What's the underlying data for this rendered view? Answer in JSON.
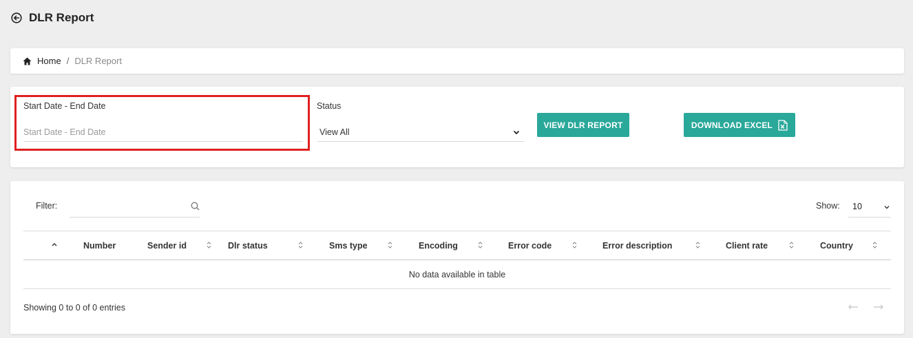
{
  "header": {
    "title": "DLR Report",
    "back_icon": "arrow-left-circle-icon"
  },
  "breadcrumb": {
    "home_label": "Home",
    "separator": "/",
    "current": "DLR Report",
    "home_icon": "home-icon"
  },
  "filters": {
    "date_label": "Start Date - End Date",
    "date_placeholder": "Start Date - End Date",
    "date_value": "",
    "status_label": "Status",
    "status_value": "View All",
    "view_button": "VIEW DLR REPORT",
    "download_button": "DOWNLOAD EXCEL"
  },
  "table": {
    "filter_label": "Filter:",
    "filter_value": "",
    "show_label": "Show:",
    "show_value": "10",
    "columns": [
      "Number",
      "Sender id",
      "Dlr status",
      "Sms type",
      "Encoding",
      "Error code",
      "Error description",
      "Client rate",
      "Country"
    ],
    "empty_message": "No data available in table",
    "info": "Showing 0 to 0 of 0 entries",
    "prev_label": "←",
    "next_label": "→"
  },
  "colors": {
    "accent": "#2aa89a",
    "highlight": "#e02020",
    "background": "#efeeef"
  }
}
